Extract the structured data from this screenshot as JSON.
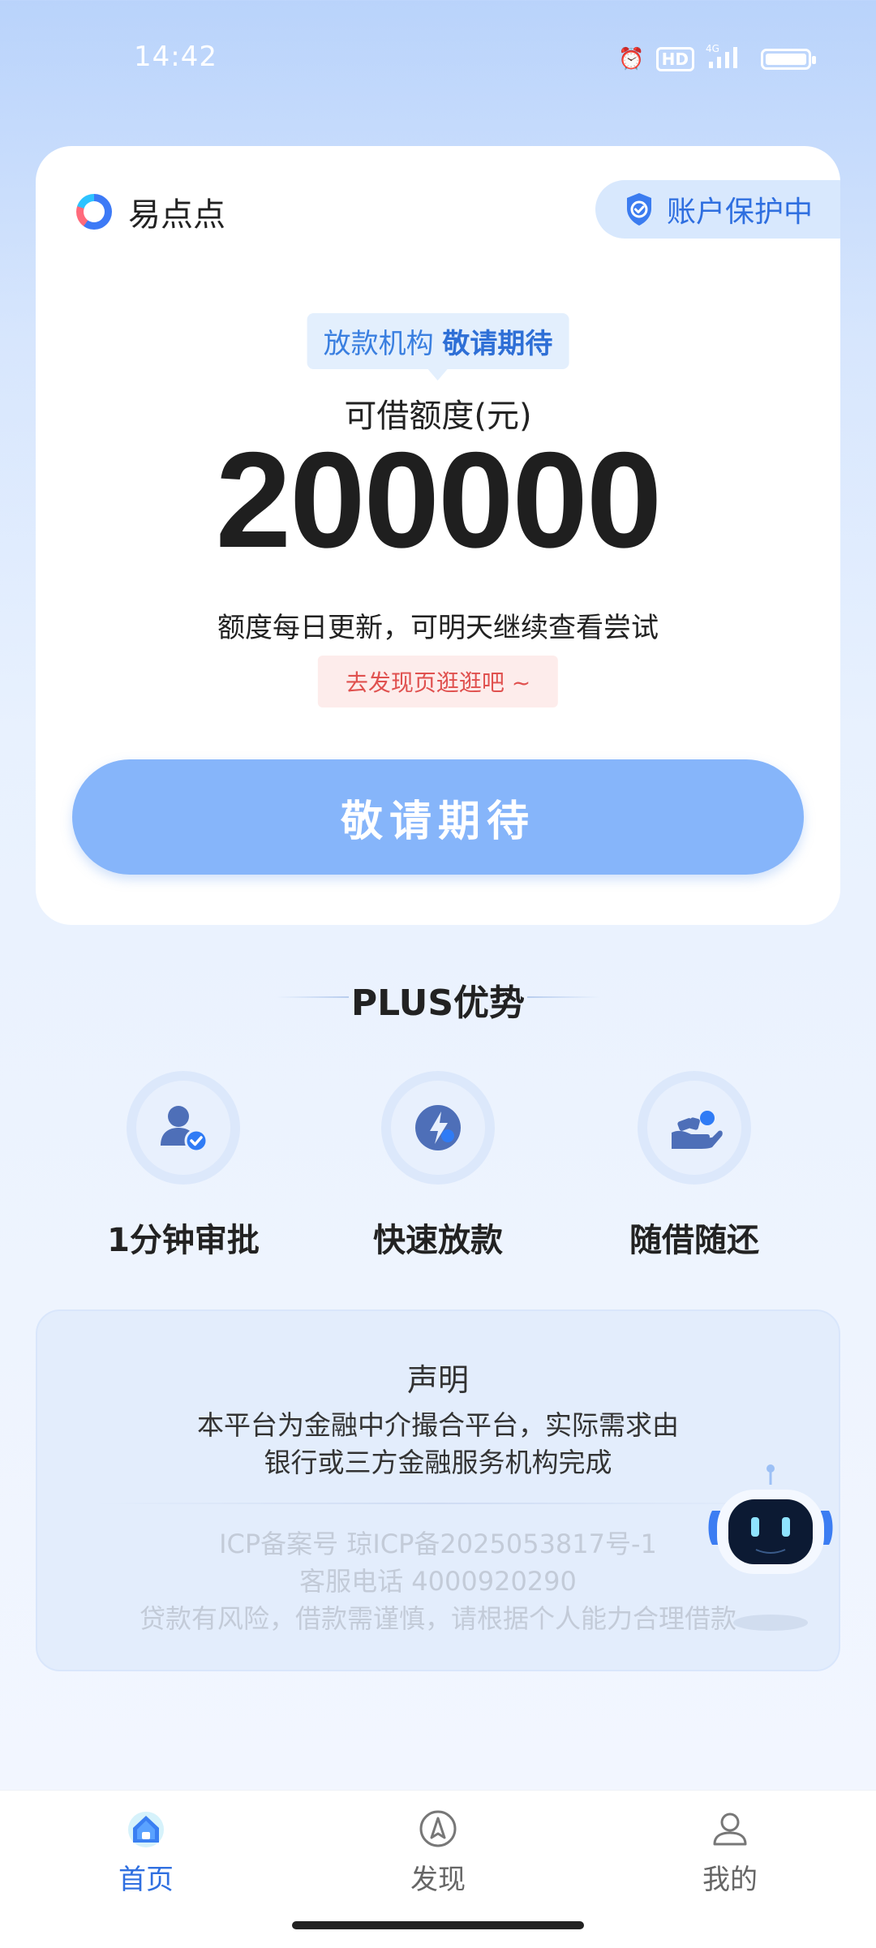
{
  "status_bar": {
    "time": "14:42",
    "hd": "HD",
    "network": "4G"
  },
  "brand": {
    "name": "易点点"
  },
  "protection": {
    "label": "账户保护中"
  },
  "tag": {
    "part1": "放款机构",
    "part2": "敬请期待"
  },
  "limit": {
    "label": "可借额度(元)",
    "amount": "200000"
  },
  "hint": "额度每日更新，可明天继续查看尝试",
  "discover_hint": "去发现页逛逛吧 ~",
  "cta_label": "敬请期待",
  "plus": {
    "title": "PLUS优势",
    "features": [
      {
        "label": "1分钟审批",
        "icon": "user-check-icon"
      },
      {
        "label": "快速放款",
        "icon": "lightning-icon"
      },
      {
        "label": "随借随还",
        "icon": "hand-coin-icon"
      }
    ]
  },
  "statement": {
    "title": "声明",
    "line1": "本平台为金融中介撮合平台，实际需求由",
    "line2": "银行或三方金融服务机构完成",
    "icp": "ICP备案号 琼ICP备2025053817号-1",
    "phone": "客服电话 4000920290",
    "risk": "贷款有风险，借款需谨慎，请根据个人能力合理借款"
  },
  "tabs": [
    {
      "label": "首页",
      "icon": "home-icon",
      "active": true
    },
    {
      "label": "发现",
      "icon": "compass-icon",
      "active": false
    },
    {
      "label": "我的",
      "icon": "profile-icon",
      "active": false
    }
  ],
  "colors": {
    "accent": "#2f6fe0",
    "cta": "#86b5fa",
    "warning": "#e0514f"
  }
}
